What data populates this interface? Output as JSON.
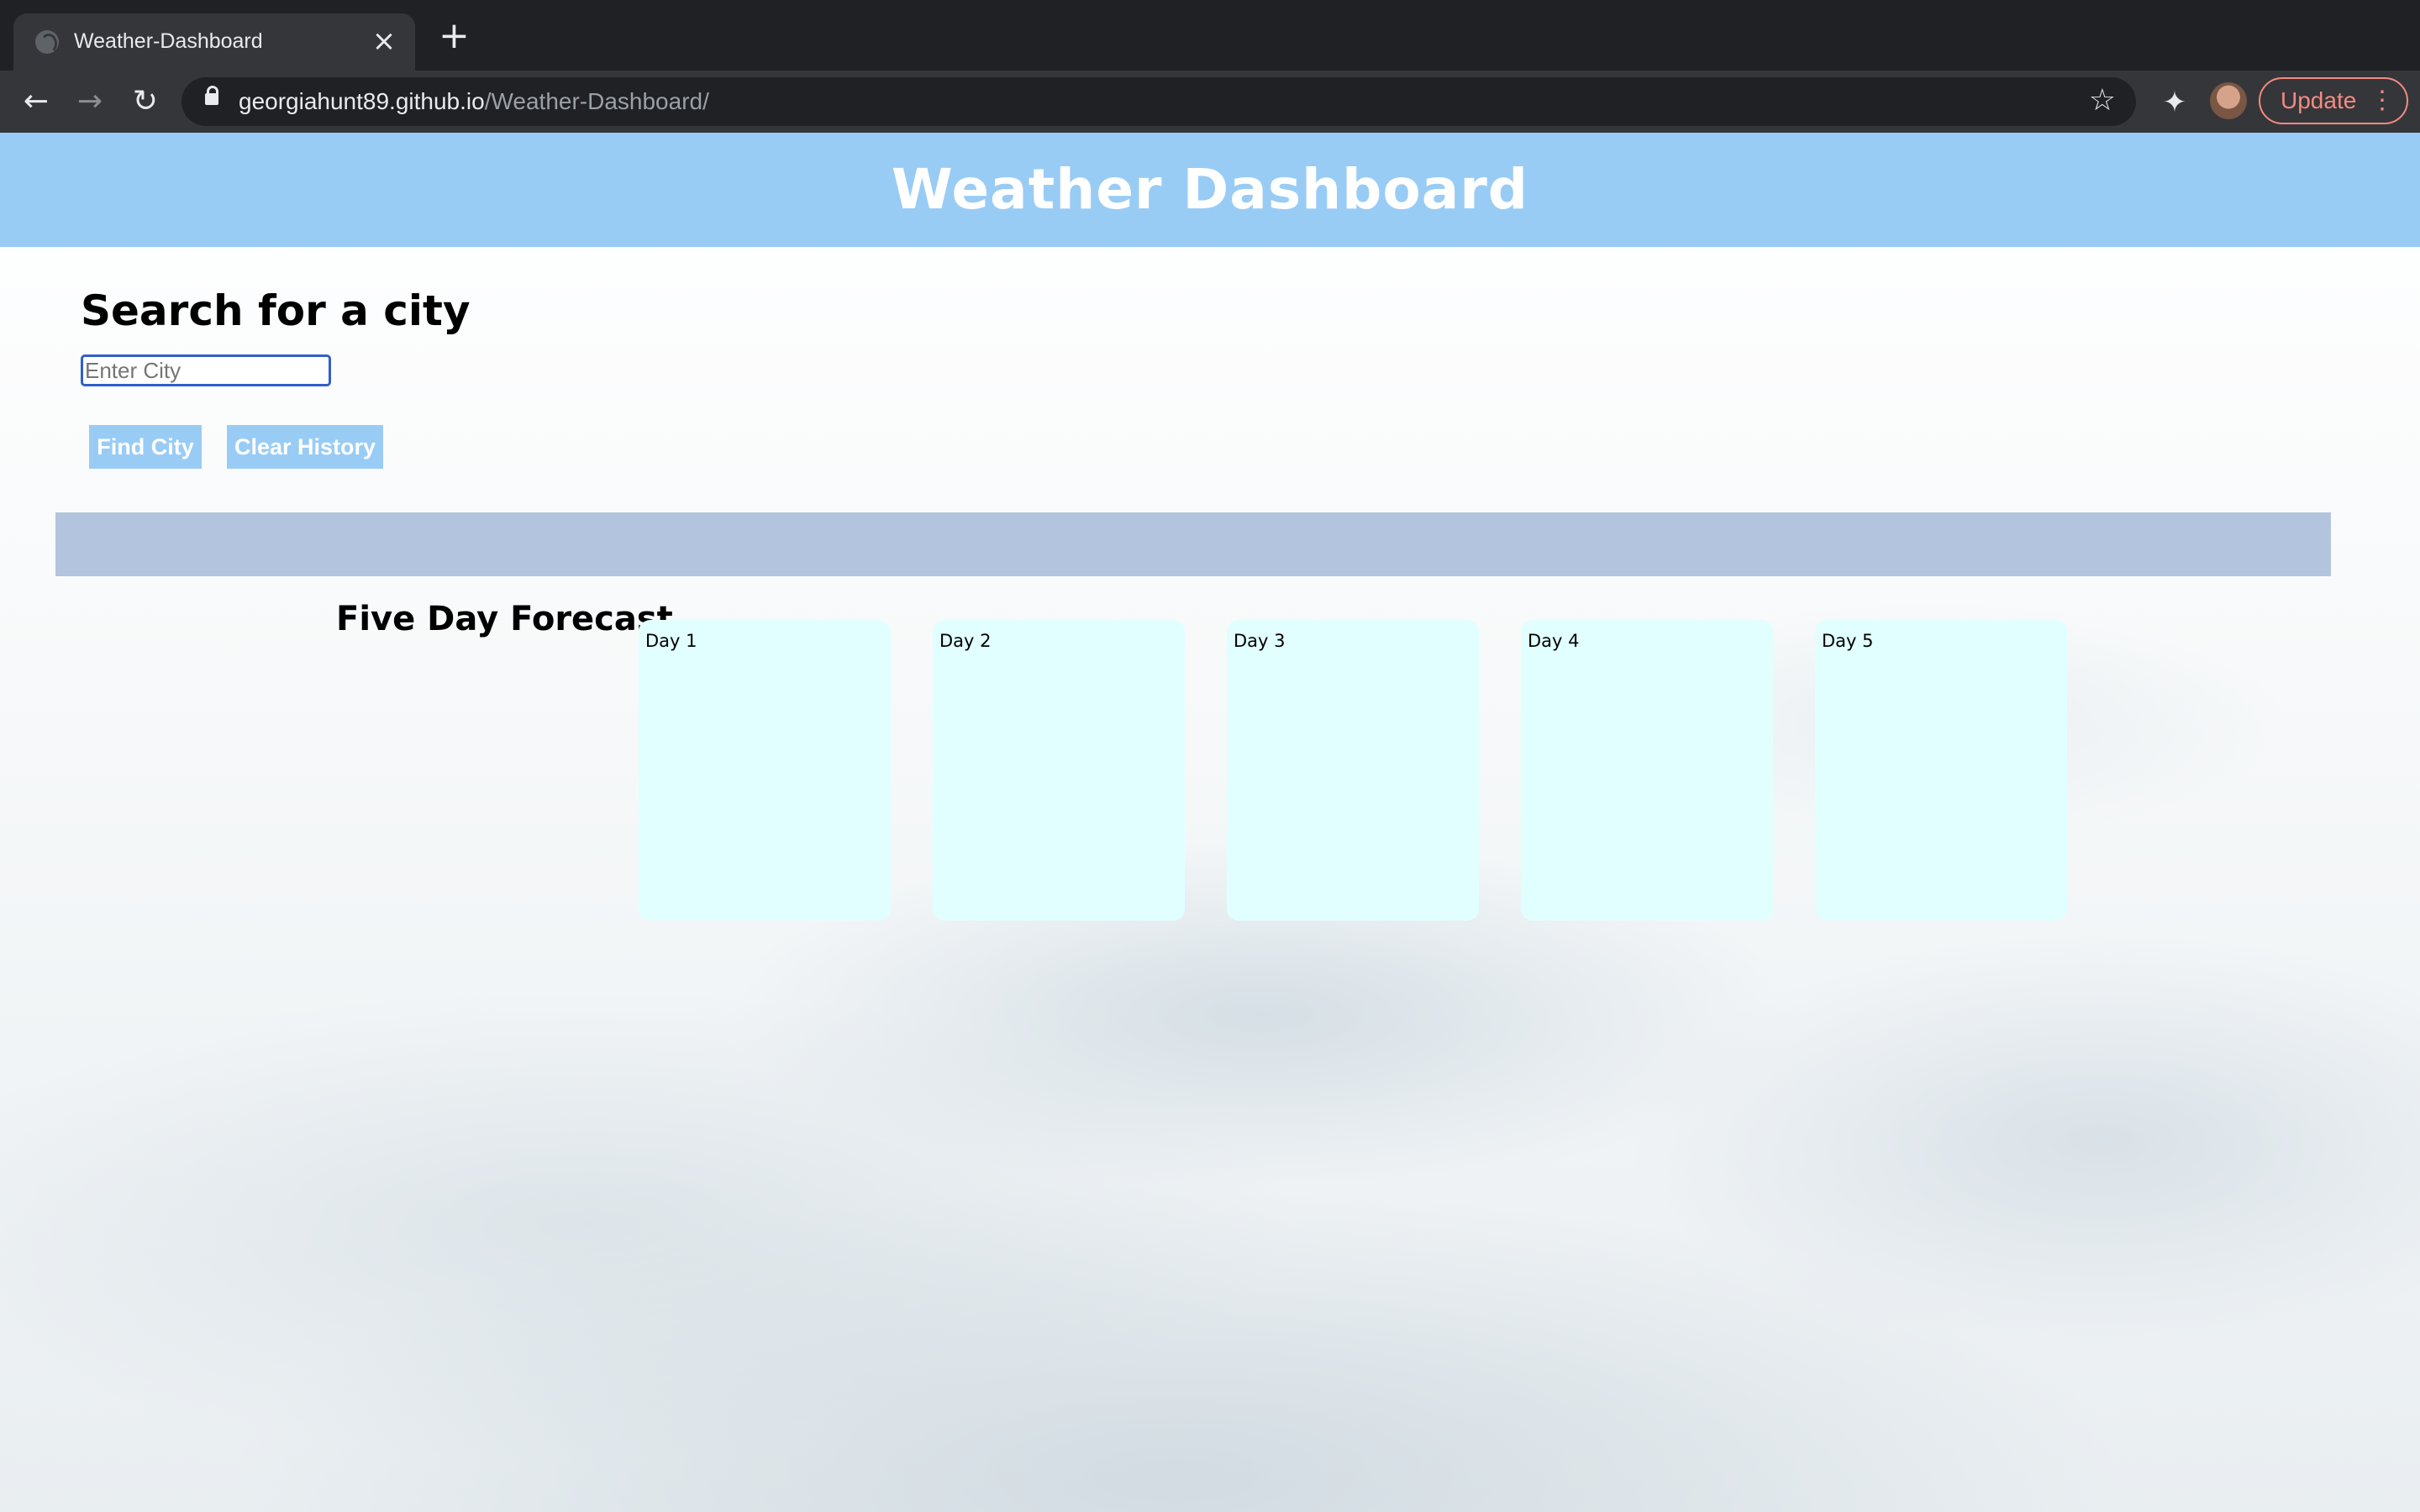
{
  "browser": {
    "tab_title": "Weather-Dashboard",
    "url_host": "georgiahunt89.github.io",
    "url_path": "/Weather-Dashboard/",
    "update_label": "Update"
  },
  "header": {
    "title": "Weather Dashboard"
  },
  "search": {
    "heading": "Search for a city",
    "placeholder": "Enter City",
    "value": "",
    "find_label": "Find City",
    "clear_label": "Clear History"
  },
  "forecast": {
    "heading": "Five Day Forecast",
    "days": [
      {
        "label": "Day 1"
      },
      {
        "label": "Day 2"
      },
      {
        "label": "Day 3"
      },
      {
        "label": "Day 4"
      },
      {
        "label": "Day 5"
      }
    ]
  },
  "colors": {
    "banner": "#99ccf5",
    "button": "#99ccf5",
    "results_bar": "#b3c4de",
    "card": "#e1ffff",
    "update_accent": "#f28b82"
  }
}
